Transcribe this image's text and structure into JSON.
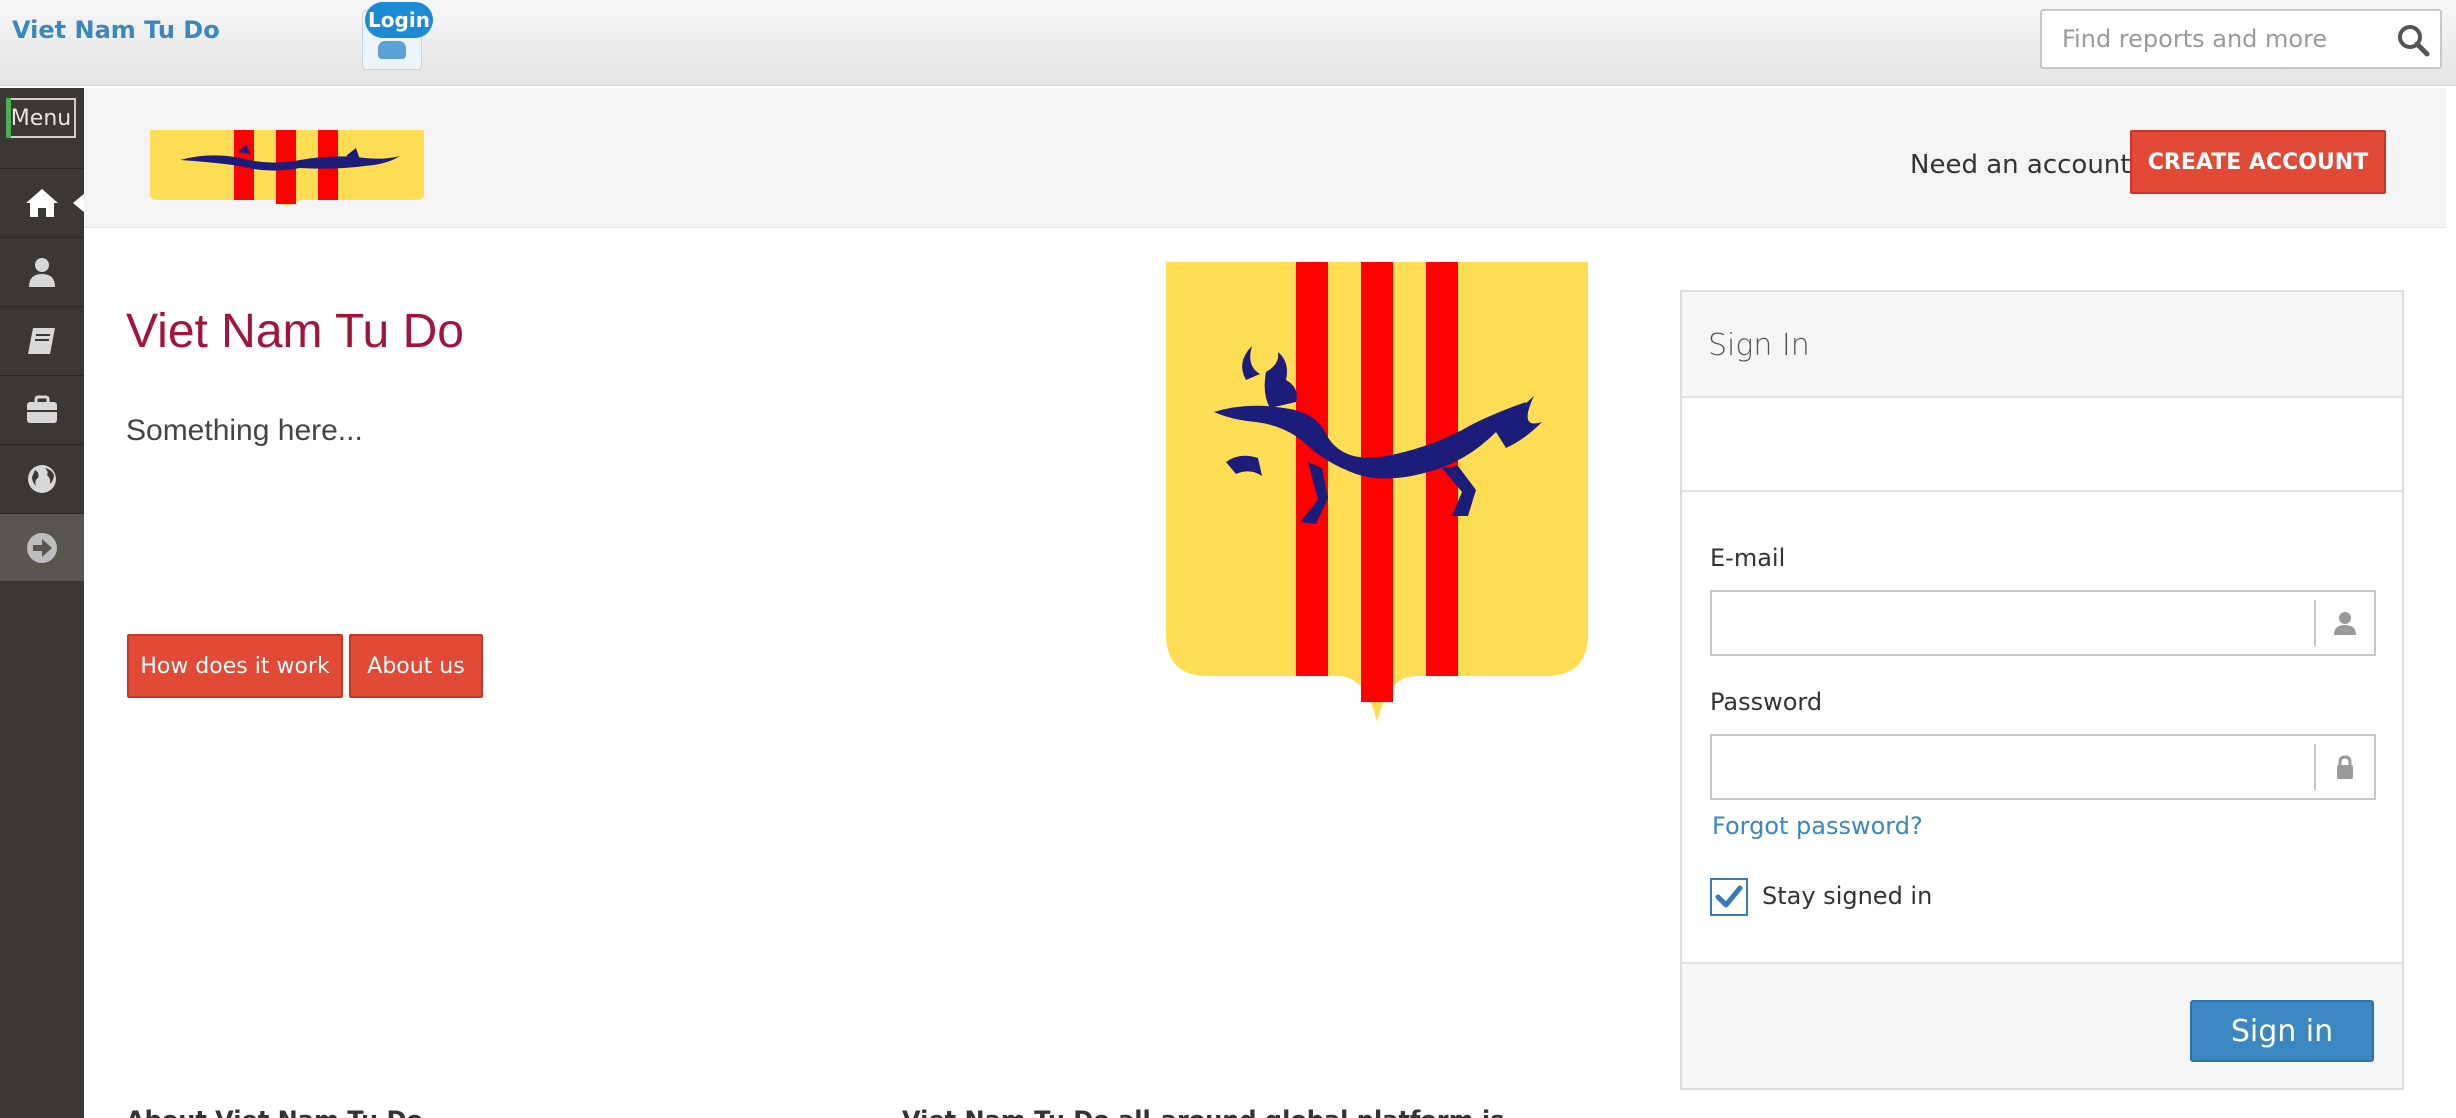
{
  "topbar": {
    "brand": "Viet Nam Tu Do",
    "login_badge": "Login",
    "search_placeholder": "Find reports and more"
  },
  "sidebar": {
    "menu_label": "Menu",
    "items": [
      {
        "name": "home",
        "icon": "home-icon",
        "active": true
      },
      {
        "name": "profile",
        "icon": "user-icon"
      },
      {
        "name": "library",
        "icon": "book-icon"
      },
      {
        "name": "jobs",
        "icon": "briefcase-icon"
      },
      {
        "name": "world",
        "icon": "globe-icon"
      },
      {
        "name": "next",
        "icon": "arrow-right-circle-icon"
      }
    ]
  },
  "header": {
    "need_account": "Need an account?",
    "create_account": "CREATE ACCOUNT"
  },
  "main": {
    "title": "Viet Nam Tu Do",
    "intro": "Something here...",
    "how_button": "How does it work",
    "about_button": "About us",
    "footer_left": "About Viet Nam Tu Do",
    "footer_right": "Viet Nam Tu Do all-around global platform is"
  },
  "signin": {
    "title": "Sign In",
    "email_label": "E-mail",
    "email_value": "",
    "password_label": "Password",
    "password_value": "",
    "forgot": "Forgot password?",
    "stay_signed_in": "Stay signed in",
    "stay_checked": true,
    "submit": "Sign in"
  },
  "colors": {
    "brand_blue": "#3a87c1",
    "accent_red": "#e14a36",
    "title_crimson": "#a3143a",
    "flag_yellow": "#ffdd55",
    "flag_red": "#ff0000",
    "dragon_navy": "#1c1c7a"
  }
}
